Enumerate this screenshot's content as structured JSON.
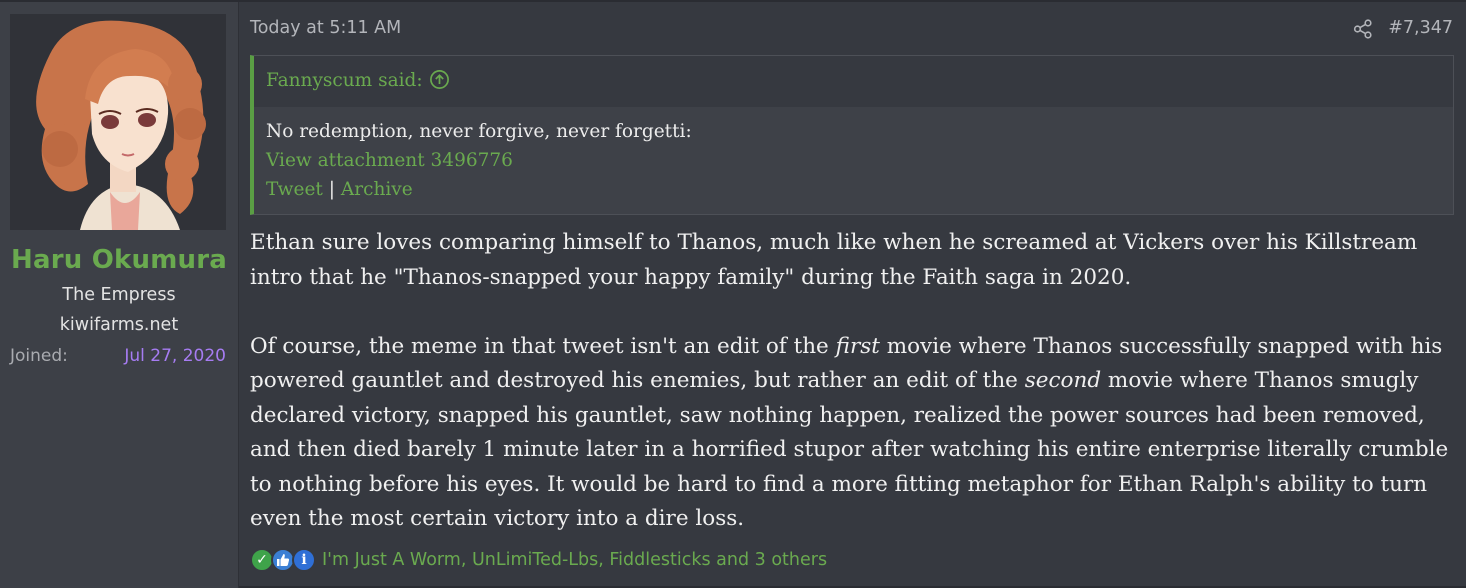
{
  "user": {
    "name": "Haru Okumura",
    "title": "The Empress",
    "site": "kiwifarms.net",
    "joined_label": "Joined:",
    "joined_date": "Jul 27, 2020"
  },
  "post": {
    "timestamp": "Today at 5:11 AM",
    "number": "#7,347",
    "share_icon": "share-icon"
  },
  "quote": {
    "author": "Fannyscum said:",
    "jump_icon": "arrow-up-circle-icon",
    "text": "No redemption, never forgive, never forgetti:",
    "attachment_link": "View attachment 3496776",
    "tweet_link": "Tweet",
    "separator": "|",
    "archive_link": "Archive"
  },
  "body": {
    "p1": "Ethan sure loves comparing himself to Thanos, much like when he screamed at Vickers over his Killstream intro that he \"Thanos-snapped your happy family\" during the Faith saga in 2020.",
    "p2_a": "Of course, the meme in that tweet isn't an edit of the ",
    "p2_em1": "first",
    "p2_b": " movie where Thanos successfully snapped with his powered gauntlet and destroyed his enemies, but rather an edit of the ",
    "p2_em2": "second",
    "p2_c": " movie where Thanos smugly declared victory, snapped his gauntlet, saw nothing happen, realized the power sources had been removed, and then died barely 1 minute later in a horrified stupor after watching his entire enterprise literally crumble to nothing before his eyes. It would be hard to find a more fitting metaphor for Ethan Ralph's ability to turn even the most certain victory into a dire loss."
  },
  "reactions": {
    "icons": [
      "check-icon",
      "thumbs-up-icon",
      "info-icon"
    ],
    "check_glyph": "✓",
    "info_glyph": "i",
    "text": "I'm Just A Worm, UnLimiTed-Lbs, Fiddlesticks and 3 others"
  },
  "colors": {
    "accent_green": "#6aaa4f",
    "joined_date": "#a67cf2",
    "background": "#363940"
  }
}
